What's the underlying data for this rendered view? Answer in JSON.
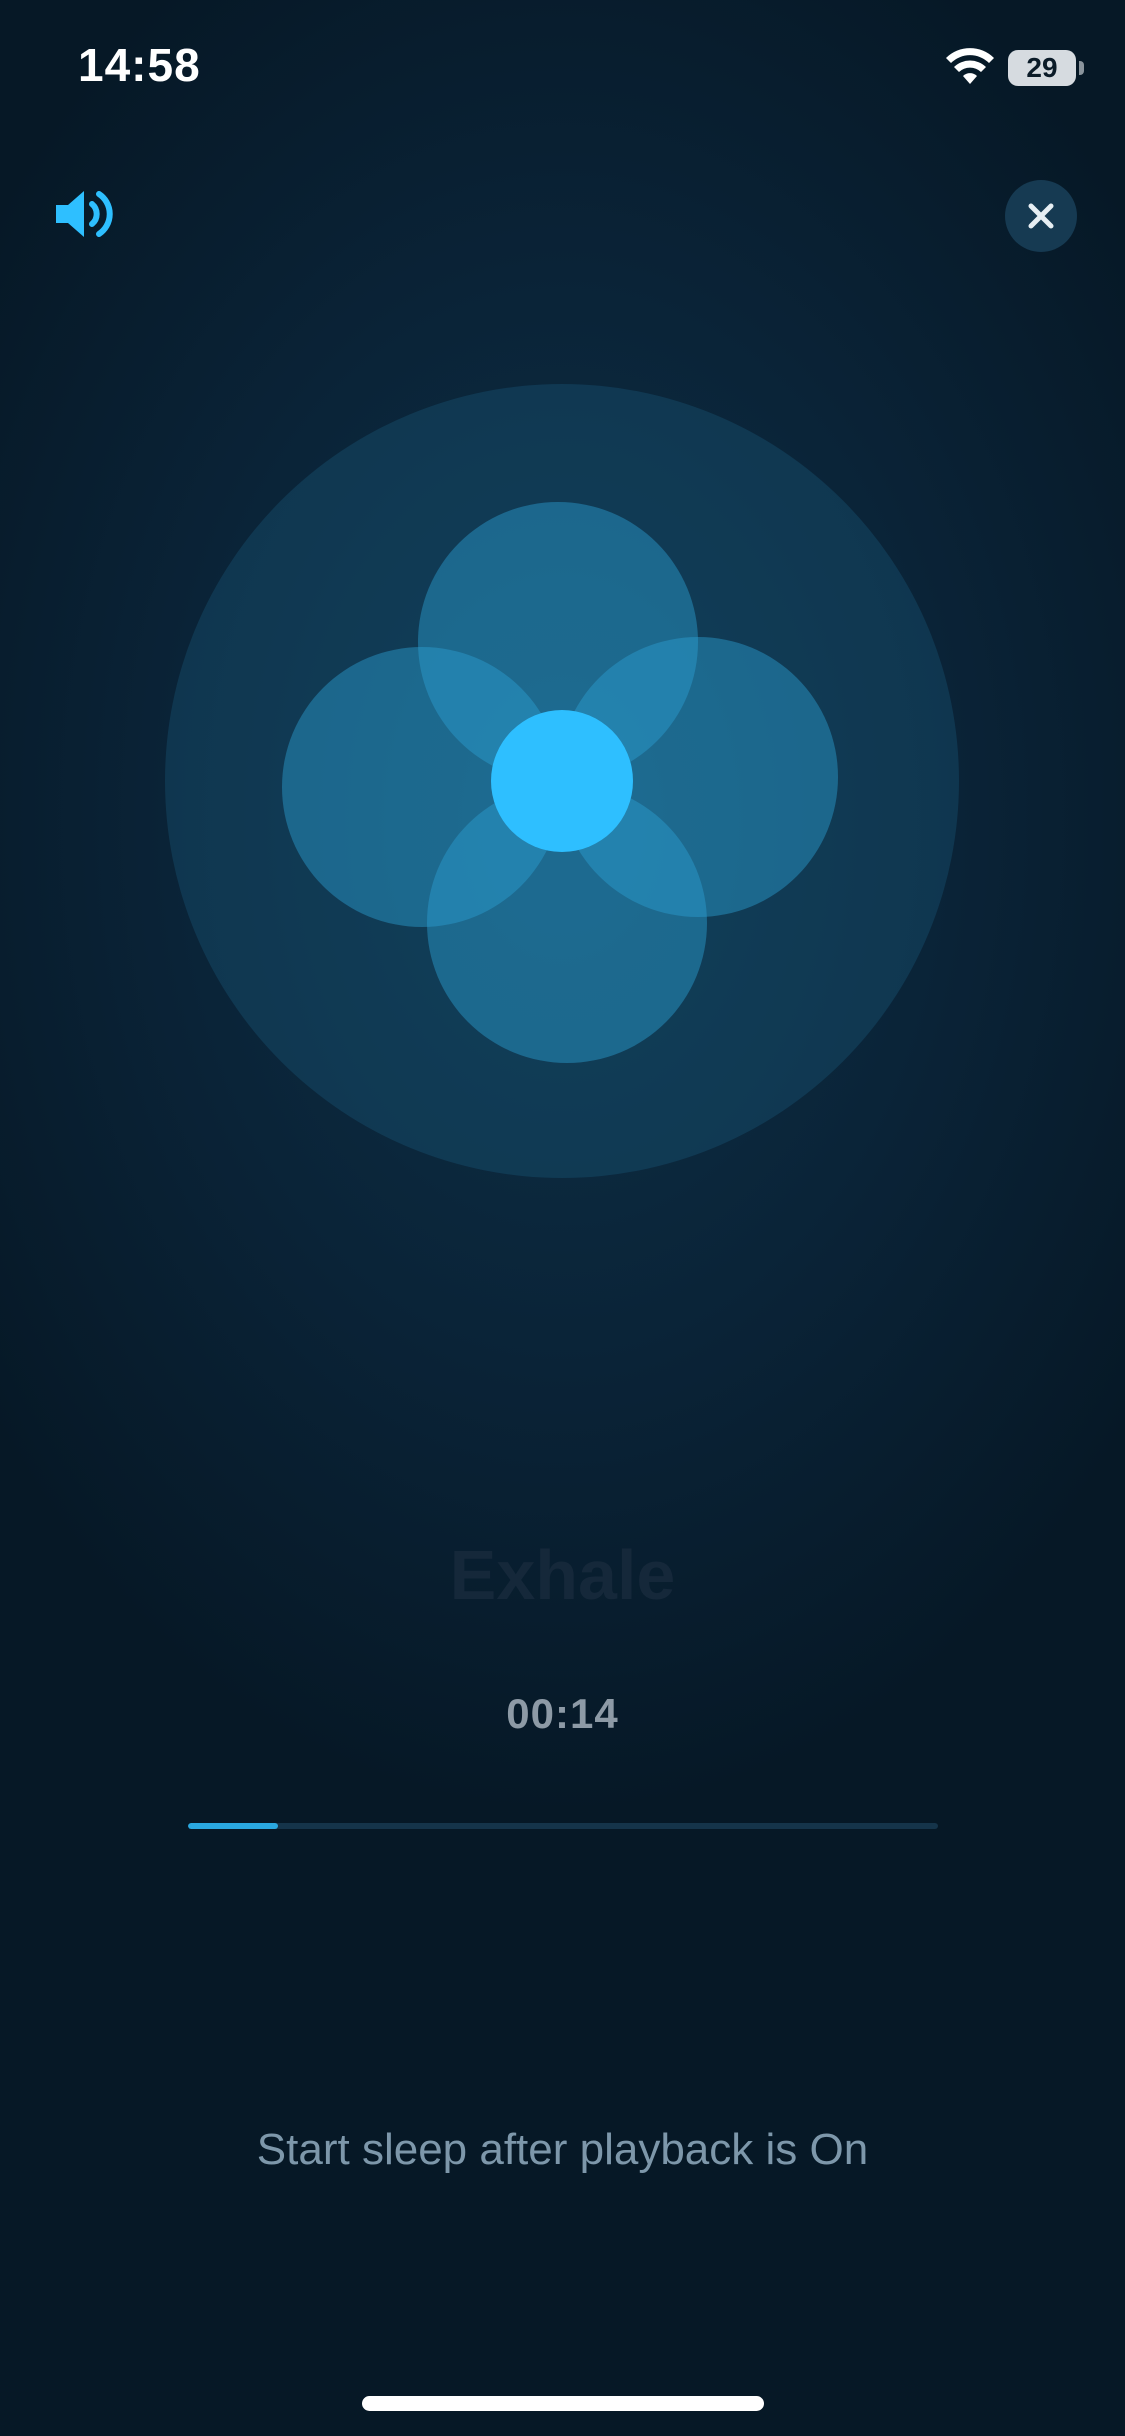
{
  "status_bar": {
    "time": "14:58",
    "battery": "29",
    "wifi_icon": "wifi-icon"
  },
  "controls": {
    "volume_icon": "speaker-volume-icon",
    "close_icon": "close-icon"
  },
  "breathing": {
    "phase": "Exhale",
    "elapsed": "00:14",
    "progress_fraction": 0.12
  },
  "footer": {
    "sleep_note": "Start sleep after playback is On"
  },
  "colors": {
    "accent": "#2ebfff",
    "petal": "#2d9fd3",
    "halo": "#1a5d7e",
    "background": "#0a2337"
  }
}
